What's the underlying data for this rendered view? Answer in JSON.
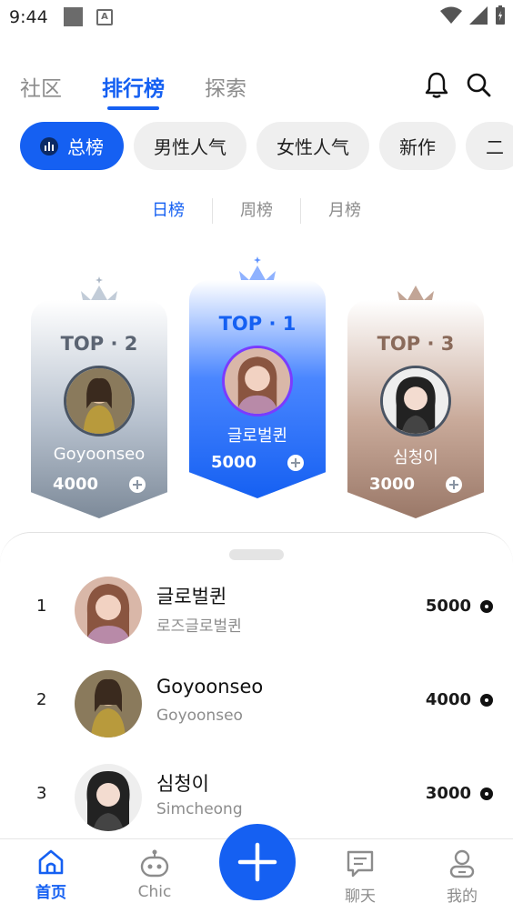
{
  "status_bar": {
    "time": "9:44",
    "a_badge": "A"
  },
  "top_tabs": [
    {
      "label": "社区",
      "active": false
    },
    {
      "label": "排行榜",
      "active": true
    },
    {
      "label": "探索",
      "active": false
    }
  ],
  "chips": [
    {
      "label": "总榜",
      "active": true
    },
    {
      "label": "男性人气",
      "active": false
    },
    {
      "label": "女性人气",
      "active": false
    },
    {
      "label": "新作",
      "active": false
    },
    {
      "label": "二",
      "active": false
    }
  ],
  "period_tabs": [
    {
      "label": "日榜",
      "active": true
    },
    {
      "label": "周榜",
      "active": false
    },
    {
      "label": "月榜",
      "active": false
    }
  ],
  "podium": {
    "first": {
      "title": "TOP · 1",
      "name": "글로벌퀸",
      "score": "5000"
    },
    "second": {
      "title": "TOP · 2",
      "name": "Goyoonseo",
      "score": "4000"
    },
    "third": {
      "title": "TOP · 3",
      "name": "심청이",
      "score": "3000"
    }
  },
  "ranking": [
    {
      "rank": "1",
      "name": "글로벌퀸",
      "sub": "로즈글로벌퀸",
      "score": "5000"
    },
    {
      "rank": "2",
      "name": "Goyoonseo",
      "sub": "Goyoonseo",
      "score": "4000"
    },
    {
      "rank": "3",
      "name": "심청이",
      "sub": "Simcheong",
      "score": "3000"
    }
  ],
  "bottom_nav": [
    {
      "label": "首页",
      "active": true
    },
    {
      "label": "Chic",
      "active": false
    },
    {
      "label": "聊天",
      "active": false
    },
    {
      "label": "我的",
      "active": false
    }
  ],
  "colors": {
    "accent": "#1560f2",
    "silver": "#7d8a99",
    "bronze": "#9a7868"
  }
}
